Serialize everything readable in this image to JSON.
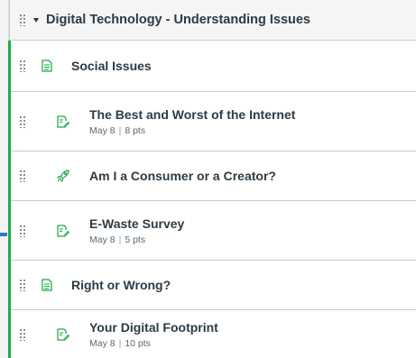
{
  "module": {
    "title": "Digital Technology - Understanding Issues",
    "expanded_caret_icon": "caret-down-icon",
    "drag_icon": "drag-handle-icon"
  },
  "items": [
    {
      "kind": "subheader",
      "title": "Social Issues",
      "icon": "page-icon"
    },
    {
      "kind": "assignment",
      "title": "The Best and Worst of the Internet",
      "date": "May 8",
      "points": "8 pts",
      "icon": "assignment-icon"
    },
    {
      "kind": "quiz",
      "title": "Am I a Consumer or a Creator?",
      "icon": "quiz-rocket-icon"
    },
    {
      "kind": "assignment",
      "title": "E-Waste Survey",
      "date": "May 8",
      "points": "5 pts",
      "icon": "assignment-icon"
    },
    {
      "kind": "subheader",
      "title": "Right or Wrong?",
      "icon": "page-icon"
    },
    {
      "kind": "assignment",
      "title": "Your Digital Footprint",
      "date": "May 8",
      "points": "10 pts",
      "icon": "assignment-icon"
    }
  ],
  "colors": {
    "published_green": "#1faa4b",
    "text": "#2d3b45",
    "muted": "#5b6770",
    "accent_blue": "#2b7abc"
  }
}
